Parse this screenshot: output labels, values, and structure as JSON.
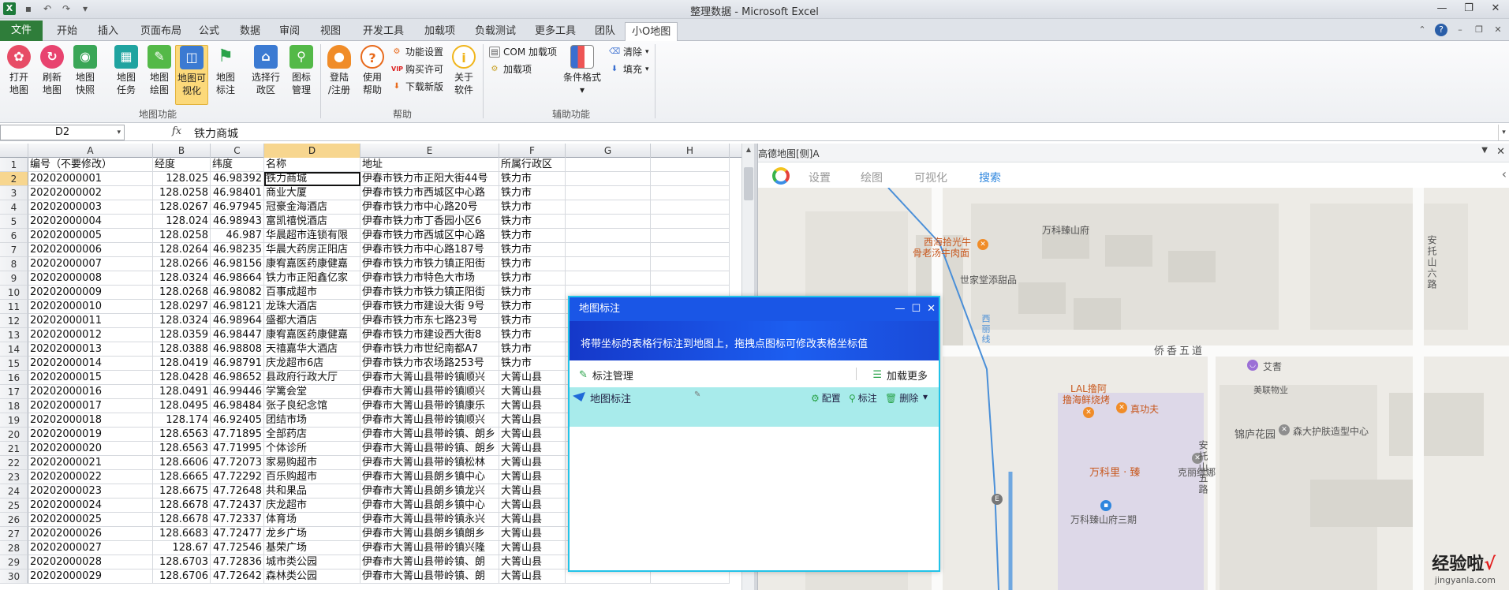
{
  "window": {
    "title": "整理数据 - Microsoft Excel"
  },
  "tabs": [
    "文件",
    "开始",
    "插入",
    "页面布局",
    "公式",
    "数据",
    "审阅",
    "视图",
    "开发工具",
    "加载项",
    "负载测试",
    "更多工具",
    "团队",
    "小O地图"
  ],
  "ribbon": {
    "map_buttons": [
      {
        "label1": "打开",
        "label2": "地图",
        "icon": "flower-icon"
      },
      {
        "label1": "刷新",
        "label2": "地图",
        "icon": "refresh-icon"
      },
      {
        "label1": "地图",
        "label2": "快照",
        "icon": "camera-icon"
      },
      {
        "label1": "地图",
        "label2": "任务",
        "icon": "calendar-icon"
      },
      {
        "label1": "地图",
        "label2": "绘图",
        "icon": "pencil-icon"
      },
      {
        "label1": "地图可",
        "label2": "视化",
        "icon": "chart-icon"
      },
      {
        "label1": "地图",
        "label2": "标注",
        "icon": "flag-icon"
      },
      {
        "label1": "选择行",
        "label2": "政区",
        "icon": "region-icon"
      },
      {
        "label1": "图标",
        "label2": "管理",
        "icon": "pin-icon"
      }
    ],
    "help_buttons": [
      {
        "label1": "登陆",
        "label2": "/注册",
        "icon": "person-icon"
      },
      {
        "label1": "使用",
        "label2": "帮助",
        "icon": "question-icon"
      },
      {
        "label1": "关于",
        "label2": "软件",
        "icon": "info-icon"
      }
    ],
    "help_small": [
      "功能设置",
      "购买许可",
      "下载新版"
    ],
    "aux_small": [
      "COM 加载项",
      "加载项"
    ],
    "cond_format": "条件格式",
    "clear": "清除",
    "fill": "填充",
    "group_labels": [
      "地图功能",
      "帮助",
      "辅助功能"
    ]
  },
  "formula_bar": {
    "name_box": "D2",
    "fx": "fx",
    "value": "铁力商城"
  },
  "sheet": {
    "columns": [
      "A",
      "B",
      "C",
      "D",
      "E",
      "F",
      "G",
      "H"
    ],
    "selected_column": "D",
    "selected_row": 2,
    "rows": [
      [
        "1",
        "编号（不要修改）",
        "经度",
        "纬度",
        "名称",
        "地址",
        "所属行政区"
      ],
      [
        "2",
        "20202000001",
        "128.025",
        "46.98392",
        "铁力商城",
        "伊春市铁力市正阳大街44号",
        "铁力市"
      ],
      [
        "3",
        "20202000002",
        "128.0258",
        "46.98401",
        "商业大厦",
        "伊春市铁力市西城区中心路",
        "铁力市"
      ],
      [
        "4",
        "20202000003",
        "128.0267",
        "46.97945",
        "冠豪金海酒店",
        "伊春市铁力市中心路20号",
        "铁力市"
      ],
      [
        "5",
        "20202000004",
        "128.024",
        "46.98943",
        "富凯禧悦酒店",
        "伊春市铁力市丁香园小区6",
        "铁力市"
      ],
      [
        "6",
        "20202000005",
        "128.0258",
        "46.987",
        "华晨超市连锁有限",
        "伊春市铁力市西城区中心路",
        "铁力市"
      ],
      [
        "7",
        "20202000006",
        "128.0264",
        "46.98235",
        "华晨大药房正阳店",
        "伊春市铁力市中心路187号",
        "铁力市"
      ],
      [
        "8",
        "20202000007",
        "128.0266",
        "46.98156",
        "康宥嘉医药康健嘉",
        "伊春市铁力市铁力镇正阳街",
        "铁力市"
      ],
      [
        "9",
        "20202000008",
        "128.0324",
        "46.98664",
        "铁力市正阳鑫亿家",
        "伊春市铁力市特色大市场",
        "铁力市"
      ],
      [
        "10",
        "20202000009",
        "128.0268",
        "46.98082",
        "百事成超市",
        "伊春市铁力市铁力镇正阳街",
        "铁力市"
      ],
      [
        "11",
        "20202000010",
        "128.0297",
        "46.98121",
        "龙珠大酒店",
        "伊春市铁力市建设大街 9号",
        "铁力市"
      ],
      [
        "12",
        "20202000011",
        "128.0324",
        "46.98964",
        "盛都大酒店",
        "伊春市铁力市东七路23号",
        "铁力市"
      ],
      [
        "13",
        "20202000012",
        "128.0359",
        "46.98447",
        "康宥嘉医药康健嘉",
        "伊春市铁力市建设西大街8",
        "铁力市"
      ],
      [
        "14",
        "20202000013",
        "128.0388",
        "46.98808",
        "天禧嘉华大酒店",
        "伊春市铁力市世纪南都A7",
        "铁力市"
      ],
      [
        "15",
        "20202000014",
        "128.0419",
        "46.98791",
        "庆龙超市6店",
        "伊春市铁力市农场路253号",
        "铁力市"
      ],
      [
        "16",
        "20202000015",
        "128.0428",
        "46.98652",
        "县政府行政大厅",
        "伊春市大箐山县带岭镇顺兴",
        "大箐山县"
      ],
      [
        "17",
        "20202000016",
        "128.0491",
        "46.99446",
        "学篱会堂",
        "伊春市大箐山县带岭镇顺兴",
        "大箐山县"
      ],
      [
        "18",
        "20202000017",
        "128.0495",
        "46.98484",
        "张子良纪念馆",
        "伊春市大箐山县带岭镇康乐",
        "大箐山县"
      ],
      [
        "19",
        "20202000018",
        "128.174",
        "46.92405",
        "团结市场",
        "伊春市大箐山县带岭镇顺兴",
        "大箐山县"
      ],
      [
        "20",
        "20202000019",
        "128.6563",
        "47.71895",
        "全部药店",
        "伊春市大箐山县带岭镇、朗乡",
        "大箐山县"
      ],
      [
        "21",
        "20202000020",
        "128.6563",
        "47.71995",
        "个体诊所",
        "伊春市大箐山县带岭镇、朗乡",
        "大箐山县"
      ],
      [
        "22",
        "20202000021",
        "128.6606",
        "47.72073",
        "家易购超市",
        "伊春市大箐山县带岭镇松林",
        "大箐山县"
      ],
      [
        "23",
        "20202000022",
        "128.6665",
        "47.72292",
        "百乐购超市",
        "伊春市大箐山县朗乡镇中心",
        "大箐山县"
      ],
      [
        "24",
        "20202000023",
        "128.6675",
        "47.72648",
        "共和果品",
        "伊春市大箐山县朗乡镇龙兴",
        "大箐山县"
      ],
      [
        "25",
        "20202000024",
        "128.6678",
        "47.72437",
        "庆龙超市",
        "伊春市大箐山县朗乡镇中心",
        "大箐山县"
      ],
      [
        "26",
        "20202000025",
        "128.6678",
        "47.72337",
        "体育场",
        "伊春市大箐山县带岭镇永兴",
        "大箐山县"
      ],
      [
        "27",
        "20202000026",
        "128.6683",
        "47.72477",
        "龙乡广场",
        "伊春市大箐山县朗乡镇朗乡",
        "大箐山县"
      ],
      [
        "28",
        "20202000027",
        "128.67",
        "47.72546",
        "基荣广场",
        "伊春市大箐山县带岭镇兴隆",
        "大箐山县"
      ],
      [
        "29",
        "20202000028",
        "128.6703",
        "47.72836",
        "城市类公园",
        "伊春市大箐山县带岭镇、朗",
        "大箐山县"
      ],
      [
        "30",
        "20202000029",
        "128.6706",
        "47.72642",
        "森林类公园",
        "伊春市大箐山县带岭镇、朗",
        "大箐山县"
      ]
    ]
  },
  "map_pane": {
    "title": "高德地图[侧]A",
    "nav": [
      "设置",
      "绘图",
      "可视化",
      "搜索"
    ],
    "active_nav": "搜索",
    "labels": {
      "wanke_fu": "万科臻山府",
      "xihai": "西海拾光牛",
      "xihai2": "骨老汤牛肉面",
      "shijiatang": "世家堂添甜品",
      "qiaowudao": "侨香五道",
      "aiqi": "艾耆",
      "meilian": "美联物业",
      "lal": "LAL撸阿",
      "lal2": "撸海鲜烧烤",
      "zhengongfu": "真功夫",
      "jinlu": "锦庐花园",
      "sendahu": "森大护肤造型中心",
      "kelishe": "克丽缇娜",
      "wanke_li": "万科里 · 臻",
      "wanke_3": "万科臻山府三期",
      "anto6": "安托山六路",
      "anto5": "安托山五路",
      "xili": "西丽线"
    }
  },
  "dialog": {
    "title": "地图标注",
    "banner": "将带坐标的表格行标注到地图上，拖拽点图标可修改表格坐标值",
    "manage": "标注管理",
    "load_more": "加载更多",
    "item_name": "地图标注",
    "actions": [
      "配置",
      "标注",
      "删除"
    ]
  },
  "watermark": {
    "main": "经验啦",
    "check": "√",
    "sub": "jingyanla.com"
  }
}
